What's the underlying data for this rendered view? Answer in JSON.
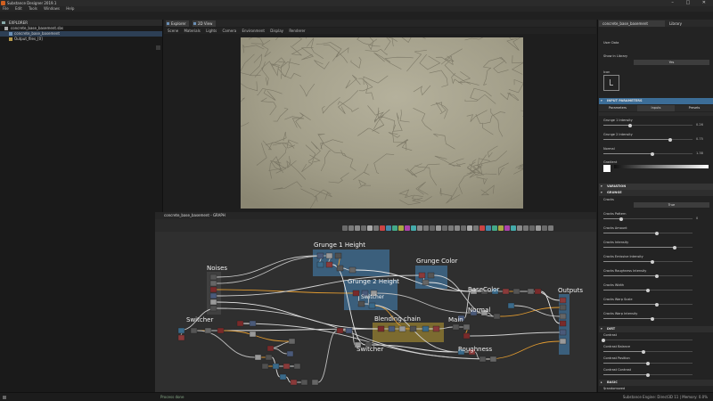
{
  "window": {
    "title": "Substance Designer 2019.1",
    "buttons": "– □ ✕"
  },
  "menu": {
    "items": [
      "File",
      "Edit",
      "Tools",
      "Windows",
      "Help"
    ]
  },
  "explorer": {
    "title": "EXPLORER",
    "items": [
      {
        "label": "concrete_base_basement.sbs",
        "icon": "package-icon"
      },
      {
        "label": "concrete_base_basement",
        "icon": "graph-icon",
        "selected": true
      },
      {
        "label": "Output_files_[0]",
        "icon": "folder-icon"
      }
    ]
  },
  "viewer": {
    "tabs": [
      "Explorer",
      "2D View"
    ],
    "toolbar": [
      "Scene",
      "Materials",
      "Lights",
      "Camera",
      "Environment",
      "Display",
      "Renderer"
    ]
  },
  "graph": {
    "tab": "concrete_base_basement - GRAPH",
    "frames": {
      "grunge1": "Grunge 1 Height",
      "grunge2": "Grunge 2 Height",
      "grunge_color": "Grunge Color",
      "blending": "Blending chain",
      "noises": "Noises",
      "switcher1": "Switcher",
      "switcher2": "Switcher",
      "switcher3": "Switcher",
      "main": "Main",
      "basecolor": "BaseColor",
      "normal": "Normal",
      "roughness": "Roughness",
      "outputs": "Outputs"
    }
  },
  "properties": {
    "tabs": [
      "concrete_base_basement",
      "Library"
    ],
    "sections": {
      "input_params": "INPUT PARAMETERS",
      "basic": "Basic",
      "grunge_settings": "Grunge",
      "dirt": "Dirt",
      "variation": "Variation"
    },
    "user_data": "User Data",
    "show_in_library": "Show in Library",
    "show_in_library_value": "Yes",
    "icon_label": "Icon",
    "subtabs": [
      "Parameters",
      "Inputs",
      "Presets"
    ],
    "params": [
      {
        "label": "Grunge 1 Intensity",
        "value": "0.26",
        "fill": 0.3
      },
      {
        "label": "Grunge 2 Intensity",
        "value": "0.75",
        "fill": 0.75
      },
      {
        "label": "Normal",
        "value": "1.38",
        "fill": 0.55
      }
    ],
    "gradient_label": "Gradient",
    "grunge_params": [
      {
        "label": "Cracks",
        "value": "True",
        "type": "button"
      },
      {
        "label": "Cracks Pattern",
        "value": "0",
        "fill": 0.2
      },
      {
        "label": "Cracks Amount",
        "value": "",
        "fill": 0.6
      },
      {
        "label": "Cracks Intensity",
        "value": "",
        "fill": 0.8
      },
      {
        "label": "Cracks Emissive Intensity",
        "value": "",
        "fill": 0.55
      },
      {
        "label": "Cracks Roughness Intensity",
        "value": "",
        "fill": 0.6
      },
      {
        "label": "Cracks Width",
        "value": "",
        "fill": 0.5
      },
      {
        "label": "Cracks Warp Scale",
        "value": "",
        "fill": 0.6
      },
      {
        "label": "Cracks Warp Intensity",
        "value": "",
        "fill": 0.55
      }
    ],
    "dirt_params": [
      {
        "label": "Contrast",
        "value": "",
        "fill": 0.0
      },
      {
        "label": "Contrast Balance",
        "value": "",
        "fill": 0.45
      },
      {
        "label": "Contrast Position",
        "value": "",
        "fill": 0.5
      },
      {
        "label": "Contrast Contrast",
        "value": "",
        "fill": 0.5
      }
    ],
    "seed_label": "$randomseed"
  },
  "status": {
    "right": "Substance Engine: Direct3D 11 | Memory: 0.0%",
    "left": "Process done"
  }
}
